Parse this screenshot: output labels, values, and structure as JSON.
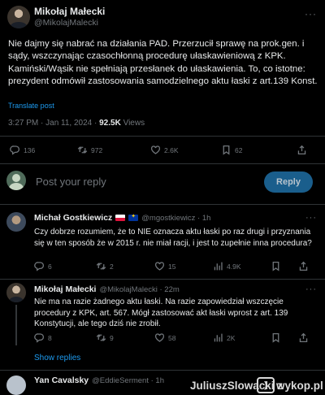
{
  "main_tweet": {
    "author_name": "Mikołaj Małecki",
    "author_handle": "@MikolajMalecki",
    "more": "···",
    "text": "Nie dajmy się nabrać na działania PAD. Przerzucił sprawę na prok.gen. i sądy, wszczynając czasochłonną procedurę ułaskawieniową z KPK. Kamiński/Wąsik nie spełniają przesłanek do ułaskawienia. To, co istotne: prezydent odmówił zastosowania samodzielnego aktu łaski z art.139 Konst.",
    "translate_label": "Translate post",
    "timestamp": "3:27 PM · Jan 11, 2024 · ",
    "views_count": "92.5K",
    "views_label": " Views",
    "stats": {
      "replies": "136",
      "reposts": "972",
      "likes": "2.6K",
      "bookmarks": "62"
    }
  },
  "compose": {
    "placeholder": "Post your reply",
    "button_label": "Reply"
  },
  "replies": [
    {
      "name": "Michał Gostkiewicz",
      "handle_time": "@mgostkiewicz · 1h",
      "text": "Czy dobrze rozumiem, że to NIE oznacza aktu łaski po raz drugi i przyznania się w ten sposób że w 2015 r. nie miał racji, i jest to zupełnie inna procedura?",
      "replies": "6",
      "reposts": "2",
      "likes": "15",
      "views": "4.9K"
    },
    {
      "name": "Mikołaj Małecki",
      "handle_time": "@MikolajMalecki · 22m",
      "text": "Nie ma na razie żadnego aktu łaski. Na razie zapowiedział wszczęcie procedury z KPK, art. 567. Mógł zastosować akt łaski wprost z art. 139 Konstytucji, ale tego dziś nie zrobił.",
      "replies": "8",
      "reposts": "9",
      "likes": "58",
      "views": "2K"
    },
    {
      "name": "Yan Cavalsky",
      "handle_time": "@EddieSerment · 1h"
    }
  ],
  "show_replies_label": "Show replies",
  "watermark": {
    "user": "JuliuszSlowacki",
    "separator": "z",
    "site": "wykop.pl"
  },
  "colors": {
    "background": "#000000",
    "accent": "#1d9bf0",
    "muted": "#71767b",
    "text": "#e7e9ea"
  }
}
